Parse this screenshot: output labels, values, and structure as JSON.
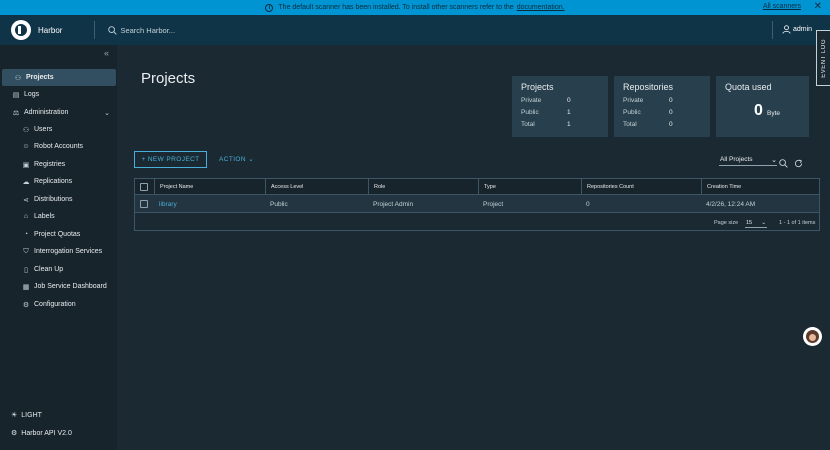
{
  "banner": {
    "message": "The default scanner has been installed. To install other scanners refer to the",
    "link": "documentation.",
    "all_scanners": "All scanners",
    "close": "✕"
  },
  "header": {
    "brand": "Harbor",
    "search_placeholder": "Search Harbor...",
    "user": "admin",
    "event_log": "EVENT LOG"
  },
  "sidebar": {
    "collapse": "«",
    "items": [
      {
        "label": "Projects",
        "icon": "projects-icon"
      },
      {
        "label": "Logs",
        "icon": "logs-icon"
      },
      {
        "label": "Administration",
        "icon": "administration-icon"
      },
      {
        "label": "Users",
        "icon": "users-icon"
      },
      {
        "label": "Robot Accounts",
        "icon": "robot-icon"
      },
      {
        "label": "Registries",
        "icon": "registries-icon"
      },
      {
        "label": "Replications",
        "icon": "replications-icon"
      },
      {
        "label": "Distributions",
        "icon": "distributions-icon"
      },
      {
        "label": "Labels",
        "icon": "labels-icon"
      },
      {
        "label": "Project Quotas",
        "icon": "quotas-icon"
      },
      {
        "label": "Interrogation Services",
        "icon": "shield-icon"
      },
      {
        "label": "Clean Up",
        "icon": "trash-icon"
      },
      {
        "label": "Job Service Dashboard",
        "icon": "dashboard-icon"
      },
      {
        "label": "Configuration",
        "icon": "gear-icon"
      }
    ],
    "theme": "LIGHT",
    "api": "Harbor API V2.0"
  },
  "main": {
    "title": "Projects",
    "cards": {
      "projects": {
        "title": "Projects",
        "rows": [
          {
            "label": "Private",
            "value": "0"
          },
          {
            "label": "Public",
            "value": "1"
          },
          {
            "label": "Total",
            "value": "1"
          }
        ]
      },
      "repositories": {
        "title": "Repositories",
        "rows": [
          {
            "label": "Private",
            "value": "0"
          },
          {
            "label": "Public",
            "value": "0"
          },
          {
            "label": "Total",
            "value": "0"
          }
        ]
      },
      "quota": {
        "title": "Quota used",
        "value": "0",
        "unit": "Byte"
      }
    },
    "new_project": "+ NEW PROJECT",
    "action": "ACTION",
    "filter": "All Projects"
  },
  "table": {
    "columns": [
      "Project Name",
      "Access Level",
      "Role",
      "Type",
      "Repositories Count",
      "Creation Time"
    ],
    "rows": [
      {
        "name": "library",
        "access": "Public",
        "role": "Project Admin",
        "type": "Project",
        "repos": "0",
        "created": "4/2/26, 12:24 AM"
      }
    ],
    "page_size_label": "Page size",
    "page_size": "15",
    "items_count": "1 - 1 of 1 items"
  },
  "colors": {
    "accent": "#49afd9",
    "banner": "#0094d3",
    "header": "#0f3347",
    "sidebar": "#17242b",
    "card": "#28404d"
  }
}
